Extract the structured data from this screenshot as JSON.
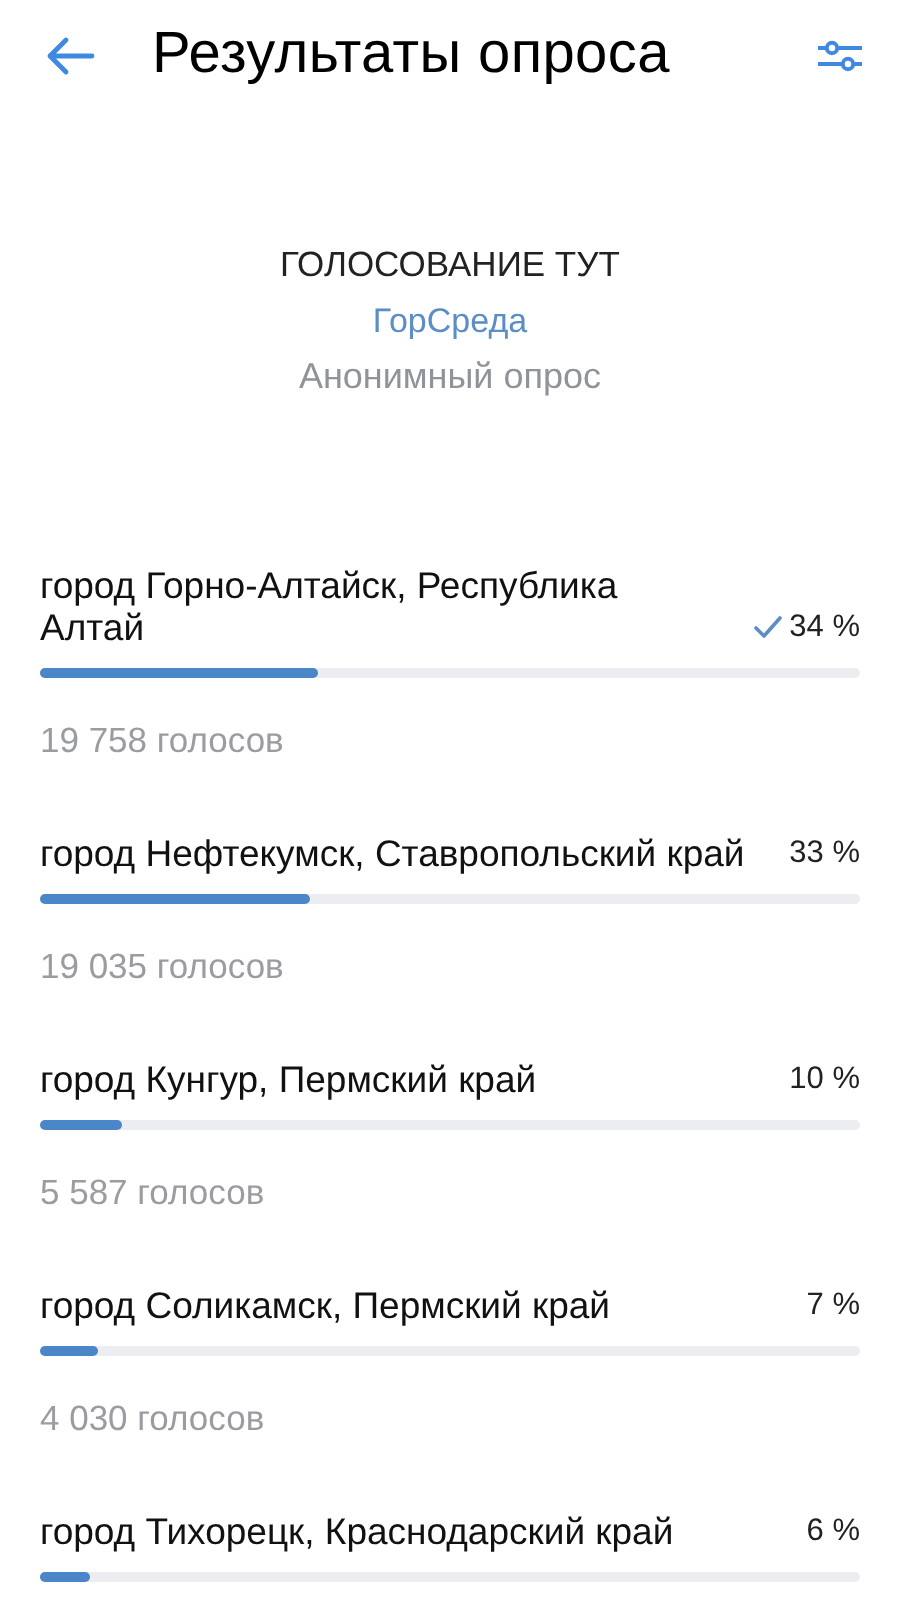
{
  "header": {
    "title": "Результаты опроса"
  },
  "poll": {
    "title": "ГОЛОСОВАНИЕ ТУТ",
    "author": "ГорСреда",
    "type": "Анонимный опрос"
  },
  "options": [
    {
      "label": "город Горно-Алтайск, Республика Алтай",
      "percent": "34 %",
      "votes": "19 758 голосов",
      "level": 0.34,
      "voted": true
    },
    {
      "label": "город Нефтекумск, Ставропольский край",
      "percent": "33 %",
      "votes": "19 035 голосов",
      "level": 0.33,
      "voted": false
    },
    {
      "label": "город Кунгур, Пермский край",
      "percent": "10 %",
      "votes": "5 587 голосов",
      "level": 0.1,
      "voted": false
    },
    {
      "label": "город Соликамск, Пермский край",
      "percent": "7 %",
      "votes": "4 030 голосов",
      "level": 0.07,
      "voted": false
    },
    {
      "label": "город Тихорецк, Краснодарский край",
      "percent": "6 %",
      "level": 0.06,
      "voted": false
    }
  ]
}
